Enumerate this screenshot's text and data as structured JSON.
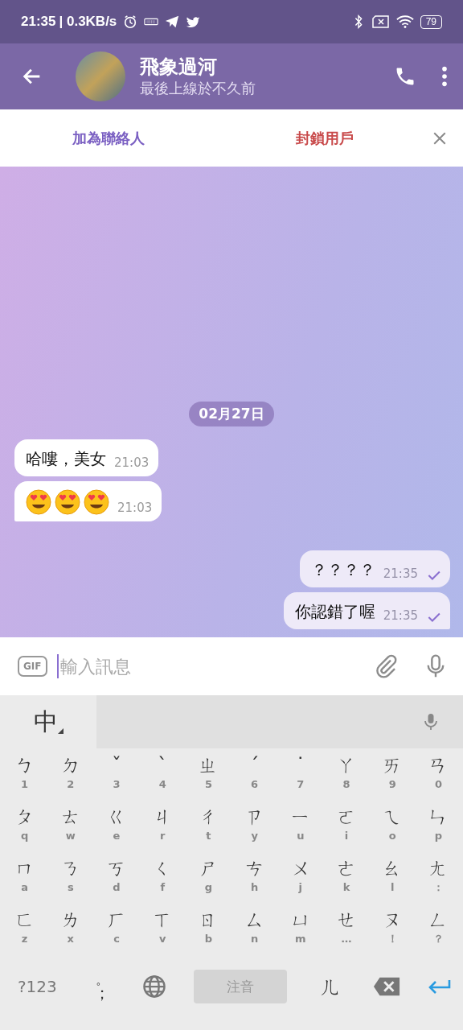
{
  "status_bar": {
    "time": "21:35",
    "speed": "| 0.3KB/s",
    "battery": "79"
  },
  "header": {
    "title": "飛象過河",
    "subtitle": "最後上線於不久前"
  },
  "action_bar": {
    "add_contact": "加為聯絡人",
    "block_user": "封鎖用戶"
  },
  "date_chip": "02月27日",
  "messages": [
    {
      "kind": "text",
      "outgoing": false,
      "text": "哈嘍，美女",
      "time": "21:03",
      "tail": false
    },
    {
      "kind": "emoji",
      "outgoing": false,
      "emojis": [
        {
          "kind": "heart-eyes"
        },
        {
          "kind": "heart-eyes"
        },
        {
          "kind": "heart-eyes"
        }
      ],
      "time": "21:03",
      "tail": true
    },
    {
      "kind": "text",
      "outgoing": true,
      "text": "？？？？",
      "time": "21:35",
      "tail": false,
      "read": false
    },
    {
      "kind": "text",
      "outgoing": true,
      "text": "你認錯了喔",
      "time": "21:35",
      "tail": true,
      "read": false
    }
  ],
  "composer": {
    "gif": "GIF",
    "placeholder": "輸入訊息"
  },
  "keyboard": {
    "language": "中",
    "rows": [
      [
        {
          "main": "ㄅ",
          "sub": "1"
        },
        {
          "main": "ㄉ",
          "sub": "2"
        },
        {
          "main": "ˇ",
          "sub": "3"
        },
        {
          "main": "ˋ",
          "sub": "4"
        },
        {
          "main": "ㄓ",
          "sub": "5"
        },
        {
          "main": "ˊ",
          "sub": "6"
        },
        {
          "main": "˙",
          "sub": "7"
        },
        {
          "main": "ㄚ",
          "sub": "8"
        },
        {
          "main": "ㄞ",
          "sub": "9"
        },
        {
          "main": "ㄢ",
          "sub": "0"
        }
      ],
      [
        {
          "main": "ㄆ",
          "sub": "q"
        },
        {
          "main": "ㄊ",
          "sub": "w"
        },
        {
          "main": "ㄍ",
          "sub": "e"
        },
        {
          "main": "ㄐ",
          "sub": "r"
        },
        {
          "main": "ㄔ",
          "sub": "t"
        },
        {
          "main": "ㄗ",
          "sub": "y"
        },
        {
          "main": "ㄧ",
          "sub": "u"
        },
        {
          "main": "ㄛ",
          "sub": "i"
        },
        {
          "main": "ㄟ",
          "sub": "o"
        },
        {
          "main": "ㄣ",
          "sub": "p"
        }
      ],
      [
        {
          "main": "ㄇ",
          "sub": "a"
        },
        {
          "main": "ㄋ",
          "sub": "s"
        },
        {
          "main": "ㄎ",
          "sub": "d"
        },
        {
          "main": "ㄑ",
          "sub": "f"
        },
        {
          "main": "ㄕ",
          "sub": "g"
        },
        {
          "main": "ㄘ",
          "sub": "h"
        },
        {
          "main": "ㄨ",
          "sub": "j"
        },
        {
          "main": "ㄜ",
          "sub": "k"
        },
        {
          "main": "ㄠ",
          "sub": "l"
        },
        {
          "main": "ㄤ",
          "sub": "："
        }
      ],
      [
        {
          "main": "ㄈ",
          "sub": "z"
        },
        {
          "main": "ㄌ",
          "sub": "x"
        },
        {
          "main": "ㄏ",
          "sub": "c"
        },
        {
          "main": "ㄒ",
          "sub": "v"
        },
        {
          "main": "ㄖ",
          "sub": "b"
        },
        {
          "main": "ㄙ",
          "sub": "n"
        },
        {
          "main": "ㄩ",
          "sub": "m"
        },
        {
          "main": "ㄝ",
          "sub": "…"
        },
        {
          "main": "ㄡ",
          "sub": "！"
        },
        {
          "main": "ㄥ",
          "sub": "？"
        }
      ]
    ],
    "symbols": "?123",
    "punct_top": "。",
    "punct": "；",
    "space": "注音",
    "er": "ㄦ"
  }
}
